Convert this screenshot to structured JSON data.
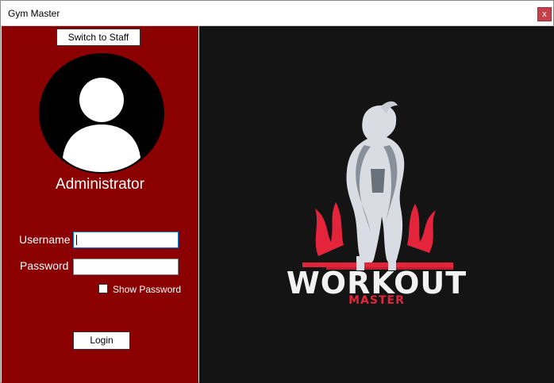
{
  "window": {
    "title": "Gym Master",
    "close_label": "x"
  },
  "left_panel": {
    "switch_button_label": "Switch to Staff",
    "avatar_icon": "user-avatar-icon",
    "role_label": "Administrator",
    "username_label": "Username",
    "username_value": "",
    "password_label": "Password",
    "password_value": "",
    "show_password_label": "Show Password",
    "show_password_checked": false,
    "login_button_label": "Login",
    "background_color": "#8b0000"
  },
  "right_panel": {
    "background_color": "#141414",
    "logo": {
      "title": "WORKOUT",
      "subtitle": "MASTER",
      "accent_color": "#e3243b",
      "icon": "muscleman-barbell-icon"
    }
  }
}
